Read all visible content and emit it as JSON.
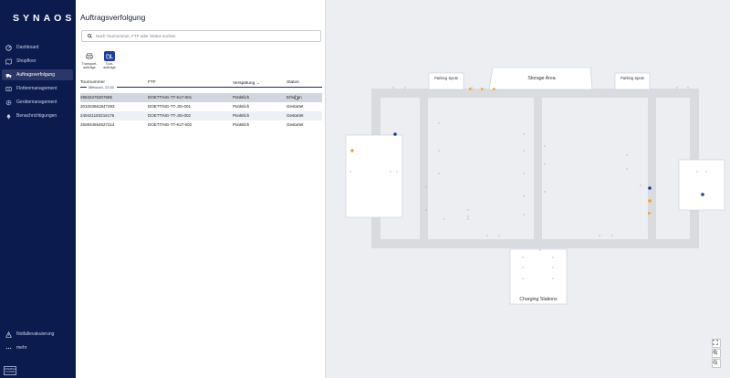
{
  "app": {
    "logo": "SYNAOS",
    "footer_badge": "INTERNAL SYSTEM"
  },
  "sidebar": {
    "items": [
      {
        "label": "Dashboard",
        "icon": "dashboard-icon",
        "active": false
      },
      {
        "label": "Shopfloor",
        "icon": "map-icon",
        "active": false
      },
      {
        "label": "Auftragsverfolgung",
        "icon": "truck-icon",
        "active": true
      },
      {
        "label": "Flottenmanagement",
        "icon": "fleet-icon",
        "active": false
      },
      {
        "label": "Gerätemanagement",
        "icon": "gear-icon",
        "active": false
      },
      {
        "label": "Benachrichtigungen",
        "icon": "bell-icon",
        "active": false
      }
    ],
    "bottom": [
      {
        "label": "Notfallevakuierung",
        "icon": "warning-icon"
      },
      {
        "label": "mehr",
        "icon": "more-icon"
      }
    ]
  },
  "panel": {
    "title": "Auftragsverfolgung",
    "search_placeholder": "Nach Tournummer, FTF oder Status suchen",
    "toggles": [
      {
        "label_line1": "Transport-",
        "label_line2": "aufträge",
        "active": false
      },
      {
        "label_line1": "Tour-",
        "label_line2": "aufträge",
        "active": true
      }
    ],
    "columns": [
      "Tournummer",
      "FTF",
      "Verspätung",
      "Status"
    ],
    "date_group": "Mittwoch, 23.02.",
    "rows": [
      {
        "tour": "29633475307685",
        "ftf": "DOETTING-TT-KLT-001",
        "delay": "Pünktlich",
        "status": "Erhalten"
      },
      {
        "tour": "201003661847293",
        "ftf": "DOETTING-TT-JIS-001",
        "delay": "Pünktlich",
        "status": "Gestartet"
      },
      {
        "tour": "240421183216176",
        "ftf": "DOETTING-TT-JIS-002",
        "delay": "Pünktlich",
        "status": "Gestartet"
      },
      {
        "tour": "250934654527214",
        "ftf": "DOETTING-TT-KLT-002",
        "delay": "Pünktlich",
        "status": "Gestartet"
      }
    ]
  },
  "map": {
    "labels": {
      "parking_left": "Parking Spots",
      "parking_right": "Parking Spots",
      "storage": "Storage Area",
      "charging": "Charging Stations"
    },
    "colors": {
      "vehicle_blue": "#1f3c9e",
      "vehicle_orange": "#f0a030",
      "road": "#d9dbdf",
      "building": "#ffffff"
    }
  }
}
